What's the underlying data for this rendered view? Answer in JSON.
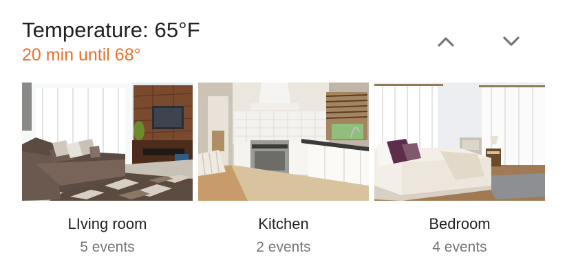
{
  "header": {
    "title": "Temperature: 65°F",
    "subtitle": "20 min until 68°",
    "subtitle_color": "#e8712a"
  },
  "nav": {
    "up_icon": "chevron-up-icon",
    "down_icon": "chevron-down-icon",
    "icon_color": "#757575"
  },
  "rooms": [
    {
      "name": "LIving room",
      "events": "5 events",
      "photo": "living-room-photo"
    },
    {
      "name": "Kitchen",
      "events": "2 events",
      "photo": "kitchen-photo"
    },
    {
      "name": "Bedroom",
      "events": "4 events",
      "photo": "bedroom-photo"
    }
  ]
}
